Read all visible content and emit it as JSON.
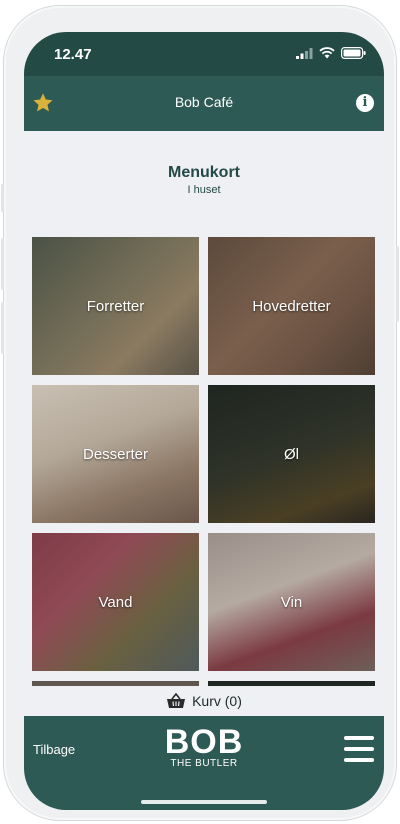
{
  "status_bar": {
    "time": "12.47"
  },
  "header": {
    "title": "Bob Café",
    "favorite_icon": "star-icon",
    "info_icon": "info-icon",
    "accent": "#d9b23b"
  },
  "menu": {
    "title": "Menukort",
    "subtitle": "I huset",
    "tiles": [
      {
        "label": "Forretter"
      },
      {
        "label": "Hovedretter"
      },
      {
        "label": "Desserter"
      },
      {
        "label": "Øl"
      },
      {
        "label": "Vand"
      },
      {
        "label": "Vin"
      }
    ]
  },
  "basket": {
    "label": "Kurv (0)",
    "icon": "basket-icon"
  },
  "footer": {
    "back_label": "Tilbage",
    "logo_text": "BOB",
    "logo_subtitle": "THE BUTLER",
    "menu_icon": "hamburger-menu-icon"
  },
  "colors": {
    "primary": "#2d5a54",
    "status_bar": "#244a46",
    "background": "#eef0f4"
  }
}
